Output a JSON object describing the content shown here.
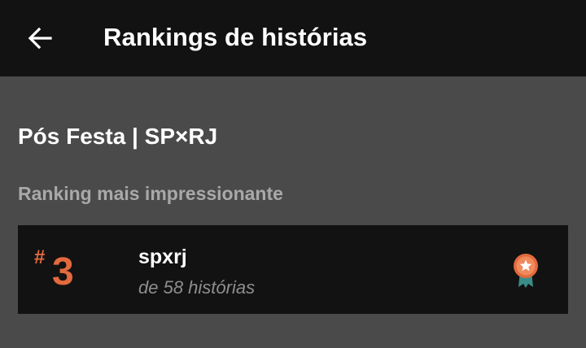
{
  "header": {
    "back_icon": "arrow-left-icon",
    "title": "Rankings de histórias"
  },
  "story": {
    "title": "Pós Festa | SP×RJ"
  },
  "ranking": {
    "section_label": "Ranking mais impressionante",
    "items": [
      {
        "hash": "#",
        "rank": "3",
        "tag": "spxrj",
        "subtitle": "de 58 histórias",
        "icon": "award-ribbon-icon"
      }
    ]
  },
  "colors": {
    "accent": "#e26a3c",
    "badge_ribbon": "#3a8c86",
    "header_bg": "#121212",
    "page_bg": "#4a4a4a",
    "card_bg": "#121212"
  }
}
